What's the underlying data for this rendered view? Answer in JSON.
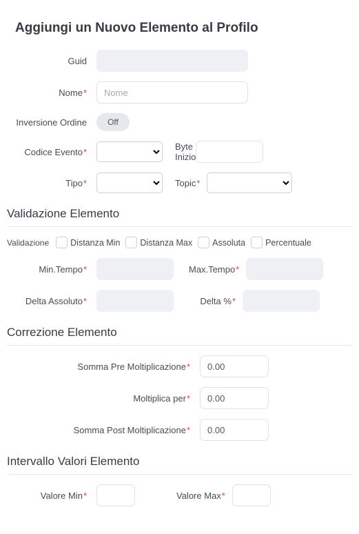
{
  "title": "Aggiungi un Nuovo Elemento al Profilo",
  "fields": {
    "guid_label": "Guid",
    "nome_label": "Nome",
    "nome_placeholder": "Nome",
    "inversione_label": "Inversione Ordine",
    "inversione_value": "Off",
    "codice_evento_label": "Codice Evento",
    "byte_inizio_label": "Byte Inizio",
    "tipo_label": "Tipo",
    "topic_label": "Topic"
  },
  "sections": {
    "validazione_title": "Validazione Elemento",
    "correzione_title": "Correzione Elemento",
    "intervallo_title": "Intervallo Valori Elemento"
  },
  "validazione": {
    "group_label": "Validazione",
    "distanza_min": "Distanza Min",
    "distanza_max": "Distanza Max",
    "assoluta": "Assoluta",
    "percentuale": "Percentuale",
    "min_tempo_label": "Min.Tempo",
    "max_tempo_label": "Max.Tempo",
    "delta_assoluto_label": "Delta Assoluto",
    "delta_pct_label": "Delta %"
  },
  "correzione": {
    "somma_pre_label": "Somma Pre Moltiplicazione",
    "somma_pre_value": "0.00",
    "moltiplica_label": "Moltiplica per",
    "moltiplica_value": "0.00",
    "somma_post_label": "Somma Post Moltiplicazione",
    "somma_post_value": "0.00"
  },
  "intervallo": {
    "valore_min_label": "Valore Min",
    "valore_max_label": "Valore Max"
  }
}
